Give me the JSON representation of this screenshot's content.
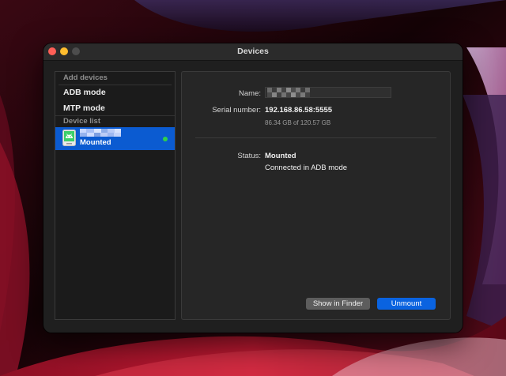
{
  "window": {
    "title": "Devices"
  },
  "sidebar": {
    "add_devices_header": "Add devices",
    "adb_mode_label": "ADB mode",
    "mtp_mode_label": "MTP mode",
    "device_list_header": "Device list",
    "devices": [
      {
        "icon": "android-device-icon",
        "name_redacted": true,
        "status": "Mounted",
        "indicator_color": "#2fd14a",
        "selected": true
      }
    ]
  },
  "detail": {
    "name_label": "Name:",
    "name_value_redacted": true,
    "serial_label": "Serial number:",
    "serial_value": "192.168.86.58:5555",
    "storage": "86.34 GB of 120.57 GB",
    "status_label": "Status:",
    "status_value": "Mounted",
    "status_detail": "Connected in ADB mode"
  },
  "buttons": {
    "show_in_finder": "Show in Finder",
    "unmount": "Unmount"
  },
  "colors": {
    "accent": "#0a63e0",
    "selection": "#0b5bd1",
    "close": "#fe5f57",
    "minimize": "#febc2e",
    "zoom_disabled": "#4d4d4d"
  }
}
